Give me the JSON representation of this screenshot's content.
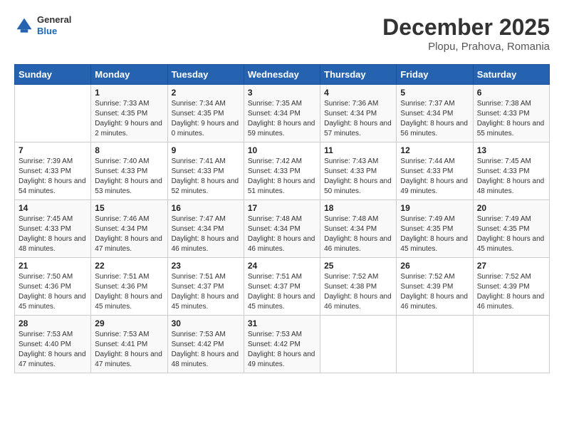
{
  "header": {
    "logo_general": "General",
    "logo_blue": "Blue",
    "title": "December 2025",
    "subtitle": "Plopu, Prahova, Romania"
  },
  "days_of_week": [
    "Sunday",
    "Monday",
    "Tuesday",
    "Wednesday",
    "Thursday",
    "Friday",
    "Saturday"
  ],
  "weeks": [
    [
      {
        "day": "",
        "sunrise": "",
        "sunset": "",
        "daylight": ""
      },
      {
        "day": "1",
        "sunrise": "Sunrise: 7:33 AM",
        "sunset": "Sunset: 4:35 PM",
        "daylight": "Daylight: 9 hours and 2 minutes."
      },
      {
        "day": "2",
        "sunrise": "Sunrise: 7:34 AM",
        "sunset": "Sunset: 4:35 PM",
        "daylight": "Daylight: 9 hours and 0 minutes."
      },
      {
        "day": "3",
        "sunrise": "Sunrise: 7:35 AM",
        "sunset": "Sunset: 4:34 PM",
        "daylight": "Daylight: 8 hours and 59 minutes."
      },
      {
        "day": "4",
        "sunrise": "Sunrise: 7:36 AM",
        "sunset": "Sunset: 4:34 PM",
        "daylight": "Daylight: 8 hours and 57 minutes."
      },
      {
        "day": "5",
        "sunrise": "Sunrise: 7:37 AM",
        "sunset": "Sunset: 4:34 PM",
        "daylight": "Daylight: 8 hours and 56 minutes."
      },
      {
        "day": "6",
        "sunrise": "Sunrise: 7:38 AM",
        "sunset": "Sunset: 4:33 PM",
        "daylight": "Daylight: 8 hours and 55 minutes."
      }
    ],
    [
      {
        "day": "7",
        "sunrise": "Sunrise: 7:39 AM",
        "sunset": "Sunset: 4:33 PM",
        "daylight": "Daylight: 8 hours and 54 minutes."
      },
      {
        "day": "8",
        "sunrise": "Sunrise: 7:40 AM",
        "sunset": "Sunset: 4:33 PM",
        "daylight": "Daylight: 8 hours and 53 minutes."
      },
      {
        "day": "9",
        "sunrise": "Sunrise: 7:41 AM",
        "sunset": "Sunset: 4:33 PM",
        "daylight": "Daylight: 8 hours and 52 minutes."
      },
      {
        "day": "10",
        "sunrise": "Sunrise: 7:42 AM",
        "sunset": "Sunset: 4:33 PM",
        "daylight": "Daylight: 8 hours and 51 minutes."
      },
      {
        "day": "11",
        "sunrise": "Sunrise: 7:43 AM",
        "sunset": "Sunset: 4:33 PM",
        "daylight": "Daylight: 8 hours and 50 minutes."
      },
      {
        "day": "12",
        "sunrise": "Sunrise: 7:44 AM",
        "sunset": "Sunset: 4:33 PM",
        "daylight": "Daylight: 8 hours and 49 minutes."
      },
      {
        "day": "13",
        "sunrise": "Sunrise: 7:45 AM",
        "sunset": "Sunset: 4:33 PM",
        "daylight": "Daylight: 8 hours and 48 minutes."
      }
    ],
    [
      {
        "day": "14",
        "sunrise": "Sunrise: 7:45 AM",
        "sunset": "Sunset: 4:33 PM",
        "daylight": "Daylight: 8 hours and 48 minutes."
      },
      {
        "day": "15",
        "sunrise": "Sunrise: 7:46 AM",
        "sunset": "Sunset: 4:34 PM",
        "daylight": "Daylight: 8 hours and 47 minutes."
      },
      {
        "day": "16",
        "sunrise": "Sunrise: 7:47 AM",
        "sunset": "Sunset: 4:34 PM",
        "daylight": "Daylight: 8 hours and 46 minutes."
      },
      {
        "day": "17",
        "sunrise": "Sunrise: 7:48 AM",
        "sunset": "Sunset: 4:34 PM",
        "daylight": "Daylight: 8 hours and 46 minutes."
      },
      {
        "day": "18",
        "sunrise": "Sunrise: 7:48 AM",
        "sunset": "Sunset: 4:34 PM",
        "daylight": "Daylight: 8 hours and 46 minutes."
      },
      {
        "day": "19",
        "sunrise": "Sunrise: 7:49 AM",
        "sunset": "Sunset: 4:35 PM",
        "daylight": "Daylight: 8 hours and 45 minutes."
      },
      {
        "day": "20",
        "sunrise": "Sunrise: 7:49 AM",
        "sunset": "Sunset: 4:35 PM",
        "daylight": "Daylight: 8 hours and 45 minutes."
      }
    ],
    [
      {
        "day": "21",
        "sunrise": "Sunrise: 7:50 AM",
        "sunset": "Sunset: 4:36 PM",
        "daylight": "Daylight: 8 hours and 45 minutes."
      },
      {
        "day": "22",
        "sunrise": "Sunrise: 7:51 AM",
        "sunset": "Sunset: 4:36 PM",
        "daylight": "Daylight: 8 hours and 45 minutes."
      },
      {
        "day": "23",
        "sunrise": "Sunrise: 7:51 AM",
        "sunset": "Sunset: 4:37 PM",
        "daylight": "Daylight: 8 hours and 45 minutes."
      },
      {
        "day": "24",
        "sunrise": "Sunrise: 7:51 AM",
        "sunset": "Sunset: 4:37 PM",
        "daylight": "Daylight: 8 hours and 45 minutes."
      },
      {
        "day": "25",
        "sunrise": "Sunrise: 7:52 AM",
        "sunset": "Sunset: 4:38 PM",
        "daylight": "Daylight: 8 hours and 46 minutes."
      },
      {
        "day": "26",
        "sunrise": "Sunrise: 7:52 AM",
        "sunset": "Sunset: 4:39 PM",
        "daylight": "Daylight: 8 hours and 46 minutes."
      },
      {
        "day": "27",
        "sunrise": "Sunrise: 7:52 AM",
        "sunset": "Sunset: 4:39 PM",
        "daylight": "Daylight: 8 hours and 46 minutes."
      }
    ],
    [
      {
        "day": "28",
        "sunrise": "Sunrise: 7:53 AM",
        "sunset": "Sunset: 4:40 PM",
        "daylight": "Daylight: 8 hours and 47 minutes."
      },
      {
        "day": "29",
        "sunrise": "Sunrise: 7:53 AM",
        "sunset": "Sunset: 4:41 PM",
        "daylight": "Daylight: 8 hours and 47 minutes."
      },
      {
        "day": "30",
        "sunrise": "Sunrise: 7:53 AM",
        "sunset": "Sunset: 4:42 PM",
        "daylight": "Daylight: 8 hours and 48 minutes."
      },
      {
        "day": "31",
        "sunrise": "Sunrise: 7:53 AM",
        "sunset": "Sunset: 4:42 PM",
        "daylight": "Daylight: 8 hours and 49 minutes."
      },
      {
        "day": "",
        "sunrise": "",
        "sunset": "",
        "daylight": ""
      },
      {
        "day": "",
        "sunrise": "",
        "sunset": "",
        "daylight": ""
      },
      {
        "day": "",
        "sunrise": "",
        "sunset": "",
        "daylight": ""
      }
    ]
  ]
}
